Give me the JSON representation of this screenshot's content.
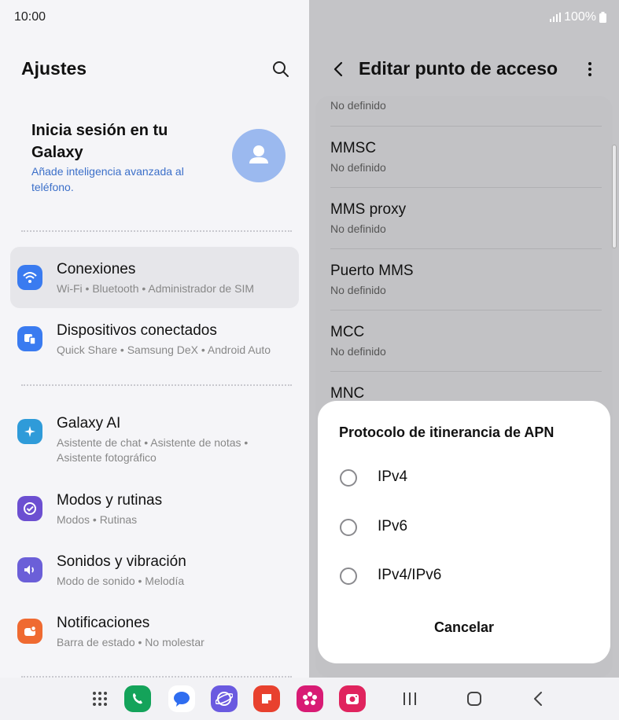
{
  "status_bar": {
    "time": "10:00",
    "battery": "100%"
  },
  "left": {
    "title": "Ajustes",
    "profile": {
      "title": "Inicia sesión en tu Galaxy",
      "subtitle": "Añade inteligencia avanzada al teléfono."
    },
    "items": [
      {
        "title": "Conexiones",
        "sub": "Wi-Fi  •  Bluetooth  •  Administrador de SIM",
        "icon": "wifi-icon",
        "color": "#3a7bf0"
      },
      {
        "title": "Dispositivos conectados",
        "sub": "Quick Share  •  Samsung DeX  •  Android Auto",
        "icon": "devices-icon",
        "color": "#3a7bf0"
      },
      {
        "title": "Galaxy AI",
        "sub": "Asistente de chat  •  Asistente de notas  •  Asistente fotográfico",
        "icon": "sparkle-icon",
        "color": "#2f9bd9"
      },
      {
        "title": "Modos y rutinas",
        "sub": "Modos  •  Rutinas",
        "icon": "check-circle-icon",
        "color": "#6c4fd1"
      },
      {
        "title": "Sonidos y vibración",
        "sub": "Modo de sonido  •  Melodía",
        "icon": "speaker-icon",
        "color": "#6b5fd8"
      },
      {
        "title": "Notificaciones",
        "sub": "Barra de estado  •  No molestar",
        "icon": "bell-icon",
        "color": "#ef6a31"
      }
    ]
  },
  "right": {
    "title": "Editar punto de acceso",
    "fields": [
      {
        "label": "",
        "value": "No definido"
      },
      {
        "label": "MMSC",
        "value": "No definido"
      },
      {
        "label": "MMS proxy",
        "value": "No definido"
      },
      {
        "label": "Puerto MMS",
        "value": "No definido"
      },
      {
        "label": "MCC",
        "value": "No definido"
      },
      {
        "label": "MNC",
        "value": ""
      }
    ]
  },
  "dialog": {
    "title": "Protocolo de itinerancia de APN",
    "options": [
      "IPv4",
      "IPv6",
      "IPv4/IPv6"
    ],
    "cancel": "Cancelar"
  },
  "dock": {
    "apps": [
      {
        "name": "phone-app",
        "color": "#14a35a"
      },
      {
        "name": "messages-app",
        "color": "#2f6df0"
      },
      {
        "name": "internet-app",
        "color": "#6a5ae0"
      },
      {
        "name": "notes-app",
        "color": "#e8412e"
      },
      {
        "name": "gallery-app",
        "color": "#d81b74"
      },
      {
        "name": "camera-app",
        "color": "#e0245e"
      }
    ]
  }
}
